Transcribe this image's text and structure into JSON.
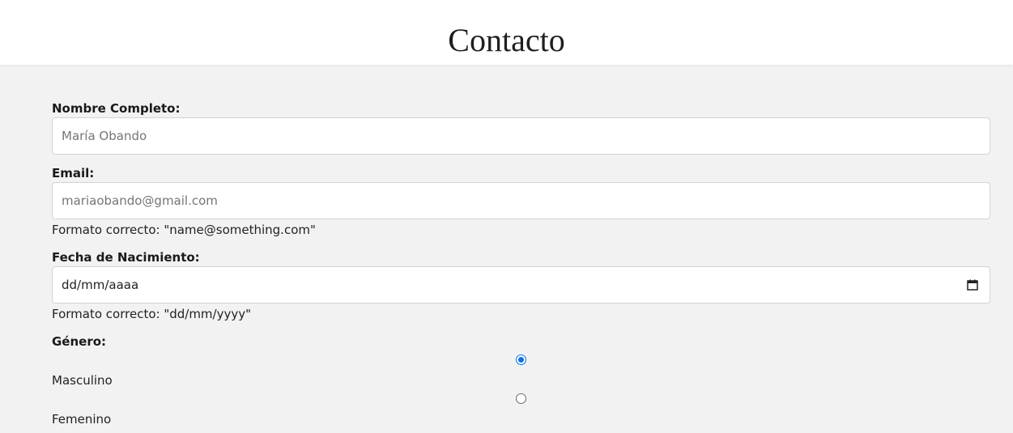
{
  "header": {
    "title": "Contacto"
  },
  "form": {
    "name": {
      "label": "Nombre Completo:",
      "placeholder": "María Obando"
    },
    "email": {
      "label": "Email:",
      "placeholder": "mariaobando@gmail.com",
      "hint": "Formato correcto: \"name@something.com\""
    },
    "birthdate": {
      "label": "Fecha de Nacimiento:",
      "value": "dd/mm/aaaa",
      "hint": "Formato correcto: \"dd/mm/yyyy\"",
      "icon": "calendar-icon"
    },
    "gender": {
      "label": "Género:",
      "options": [
        {
          "label": "Masculino",
          "checked": true
        },
        {
          "label": "Femenino",
          "checked": false
        }
      ]
    }
  },
  "colors": {
    "page_background": "#f2f2f2",
    "header_background": "#ffffff",
    "radio_accent": "#0b72e7",
    "field_border": "#cfd4da"
  }
}
